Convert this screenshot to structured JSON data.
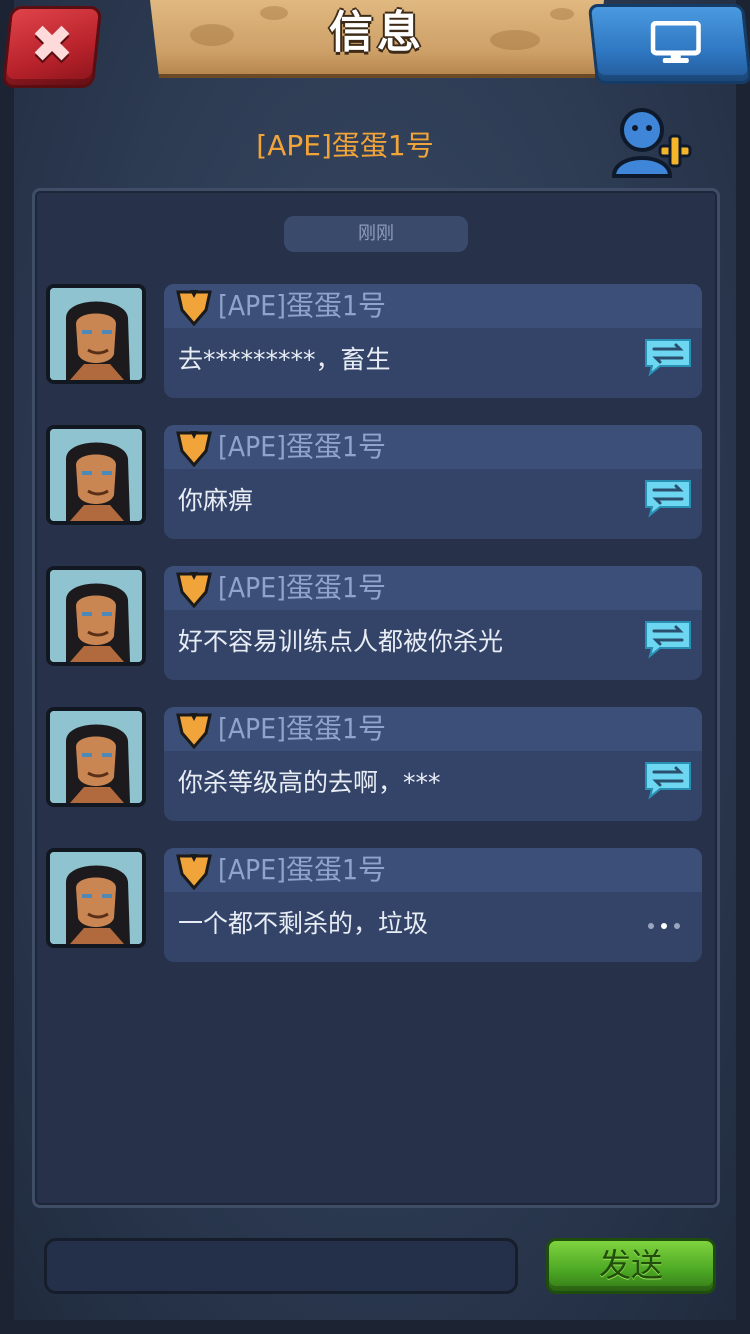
{
  "header": {
    "title": "信息",
    "close_icon": "close-icon",
    "monitor_icon": "monitor-icon"
  },
  "chat": {
    "name": "[APE]蛋蛋1号",
    "add_friend_icon": "add-friend-icon",
    "time_divider": "刚刚"
  },
  "messages": [
    {
      "sender": "[APE]蛋蛋1号",
      "text": "去*********，畜生",
      "action": "translate"
    },
    {
      "sender": "[APE]蛋蛋1号",
      "text": "你麻痹",
      "action": "translate"
    },
    {
      "sender": "[APE]蛋蛋1号",
      "text": "好不容易训练点人都被你杀光",
      "action": "translate"
    },
    {
      "sender": "[APE]蛋蛋1号",
      "text": "你杀等级高的去啊，***",
      "action": "translate"
    },
    {
      "sender": "[APE]蛋蛋1号",
      "text": "一个都不剩杀的，垃圾",
      "action": "more"
    }
  ],
  "composer": {
    "input_value": "",
    "send_label": "发送"
  },
  "colors": {
    "banner": "#cda068",
    "accent_name": "#f0a43a",
    "send_button": "#4ba724",
    "close_button": "#b8222b",
    "monitor_button": "#2f77c2"
  }
}
